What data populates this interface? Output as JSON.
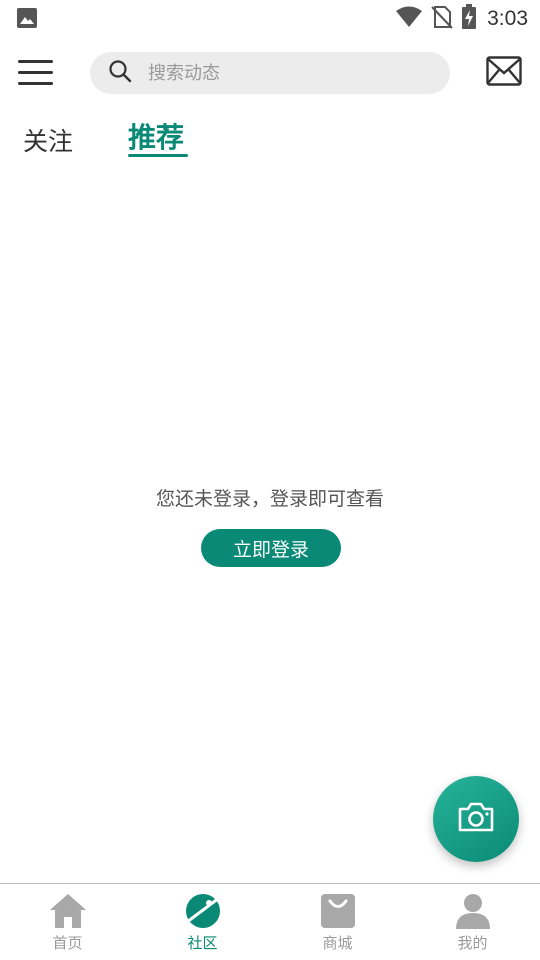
{
  "status_bar": {
    "time": "3:03",
    "icons": [
      "image-notification-icon",
      "wifi-icon",
      "no-sim-icon",
      "battery-charging-icon"
    ]
  },
  "header": {
    "search": {
      "placeholder": "搜索动态",
      "value": ""
    },
    "menu_icon": "hamburger-menu-icon",
    "mail_icon": "envelope-icon"
  },
  "tabs": [
    {
      "label": "关注",
      "active": false
    },
    {
      "label": "推荐",
      "active": true
    }
  ],
  "main": {
    "empty_message": "您还未登录，登录即可查看",
    "login_button": "立即登录"
  },
  "fab": {
    "icon": "camera-icon"
  },
  "bottom_nav": [
    {
      "label": "首页",
      "icon": "home-icon",
      "active": false
    },
    {
      "label": "社区",
      "icon": "planet-icon",
      "active": true
    },
    {
      "label": "商城",
      "icon": "shopping-bag-icon",
      "active": false
    },
    {
      "label": "我的",
      "icon": "person-icon",
      "active": false
    }
  ],
  "colors": {
    "accent": "#0a8a76",
    "inactive": "#9a9a9a",
    "search_bg": "#ececec"
  }
}
